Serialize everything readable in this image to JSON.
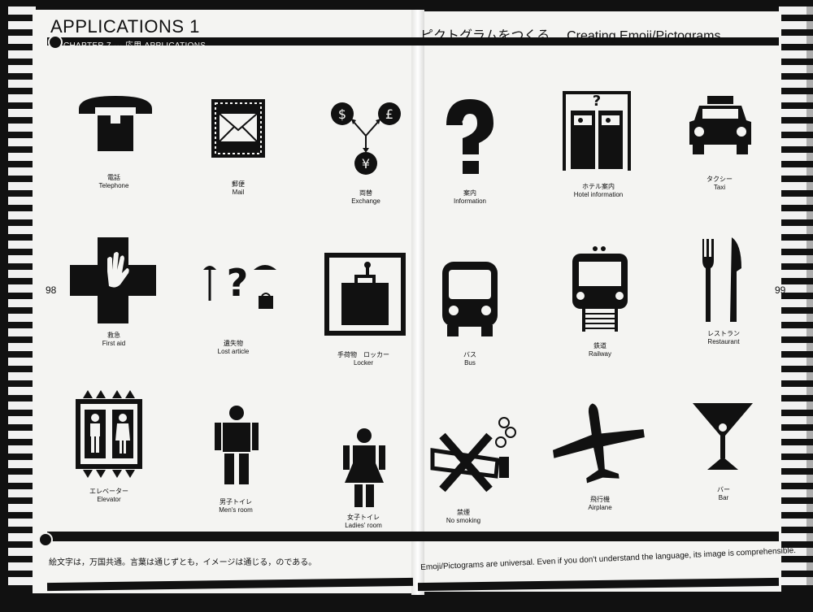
{
  "header": {
    "title": "APPLICATIONS 1",
    "chapter": "CHAPTER 7 ··· 応用 APPLICATIONS",
    "right_title_jp": "ピクトグラムをつくる",
    "right_title_en": "Creating Emoji/Pictograms"
  },
  "pages": {
    "left": "98",
    "right": "99"
  },
  "footer": {
    "left": "絵文字は，万国共通。言葉は通じずとも，イメージは通じる，のである。",
    "right": "Emoji/Pictograms are universal. Even if you don't understand the language, its image is comprehensible."
  },
  "pictograms": [
    {
      "jp": "電話",
      "en": "Telephone",
      "icon": "telephone-icon"
    },
    {
      "jp": "郵便",
      "en": "Mail",
      "icon": "mail-icon"
    },
    {
      "jp": "両替",
      "en": "Exchange",
      "icon": "exchange-icon"
    },
    {
      "jp": "案内",
      "en": "Information",
      "icon": "information-icon"
    },
    {
      "jp": "ホテル案内",
      "en": "Hotel information",
      "icon": "hotel-information-icon"
    },
    {
      "jp": "タクシー",
      "en": "Taxi",
      "icon": "taxi-icon"
    },
    {
      "jp": "救急",
      "en": "First aid",
      "icon": "first-aid-icon"
    },
    {
      "jp": "遺失物",
      "en": "Lost article",
      "icon": "lost-article-icon"
    },
    {
      "jp": "手荷物　ロッカー",
      "en": "Locker",
      "icon": "locker-icon"
    },
    {
      "jp": "バス",
      "en": "Bus",
      "icon": "bus-icon"
    },
    {
      "jp": "鉄道",
      "en": "Railway",
      "icon": "railway-icon"
    },
    {
      "jp": "レストラン",
      "en": "Restaurant",
      "icon": "restaurant-icon"
    },
    {
      "jp": "エレベーター",
      "en": "Elevator",
      "icon": "elevator-icon"
    },
    {
      "jp": "男子トイレ",
      "en": "Men's room",
      "icon": "mens-room-icon"
    },
    {
      "jp": "女子トイレ",
      "en": "Ladies' room",
      "icon": "ladies-room-icon"
    },
    {
      "jp": "禁煙",
      "en": "No smoking",
      "icon": "no-smoking-icon"
    },
    {
      "jp": "飛行機",
      "en": "Airplane",
      "icon": "airplane-icon"
    },
    {
      "jp": "バー",
      "en": "Bar",
      "icon": "bar-icon"
    }
  ]
}
